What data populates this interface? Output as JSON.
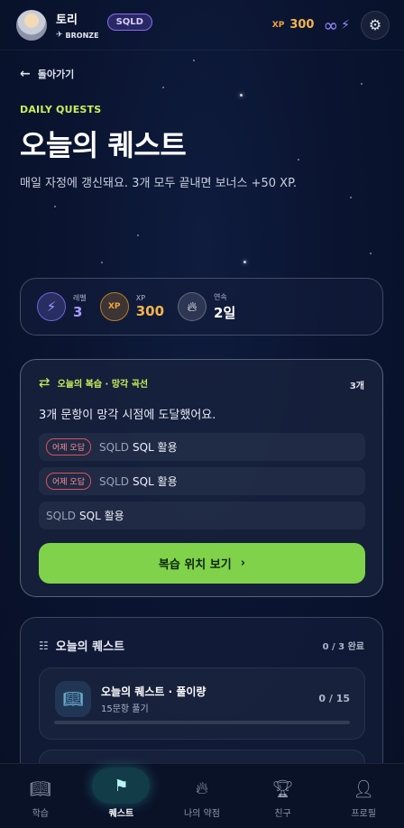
{
  "header": {
    "username": "토리",
    "rank": "BRONZE",
    "badge": "SQLD",
    "xp_label": "XP",
    "xp_value": "300",
    "streak_icon": "infinity-icon",
    "energy_icon": "bolt-icon",
    "settings_icon": "gear-icon"
  },
  "back": {
    "label": "돌아가기"
  },
  "hero": {
    "eyebrow": "DAILY QUESTS",
    "title": "오늘의 퀘스트",
    "subtitle": "매일 자정에 갱신돼요. 3개 모두 끝내면 보너스 +50 XP."
  },
  "stats": {
    "level": {
      "label": "레벨",
      "value": "3"
    },
    "xp": {
      "icon_text": "XP",
      "label": "XP",
      "value": "300"
    },
    "streak": {
      "label": "연속",
      "value": "2일"
    }
  },
  "review": {
    "label": "오늘의 복습 · 망각 곡선",
    "count": "3개",
    "message": "3개 문항이 망각 시점에 도달했어요.",
    "items": [
      {
        "tag": "어제 오답",
        "subject": "SQLD",
        "topic": "SQL 활용"
      },
      {
        "tag": "어제 오답",
        "subject": "SQLD",
        "topic": "SQL 활용"
      },
      {
        "subject": "SQLD",
        "topic": "SQL 활용"
      }
    ],
    "button_label": "복습 위치 보기"
  },
  "quests": {
    "label": "오늘의 퀘스트",
    "progress": "0 / 3 완료",
    "items": [
      {
        "title": "오늘의 퀘스트 · 풀이량",
        "subtitle": "15문항 풀기",
        "count": "0 / 15",
        "progress": 0
      }
    ]
  },
  "nav": {
    "items": [
      {
        "label": "학습",
        "icon": "book-icon"
      },
      {
        "label": "퀘스트",
        "icon": "flag-icon",
        "active": true
      },
      {
        "label": "나의 약점",
        "icon": "flame-icon"
      },
      {
        "label": "친구",
        "icon": "trophy-icon"
      },
      {
        "label": "프로필",
        "icon": "person-icon"
      }
    ]
  },
  "colors": {
    "accent_green": "#7fd24a",
    "accent_lime": "#c9f05a",
    "xp_orange": "#f5b54a",
    "level_purple": "#a69bff",
    "background": "#0a1430"
  }
}
